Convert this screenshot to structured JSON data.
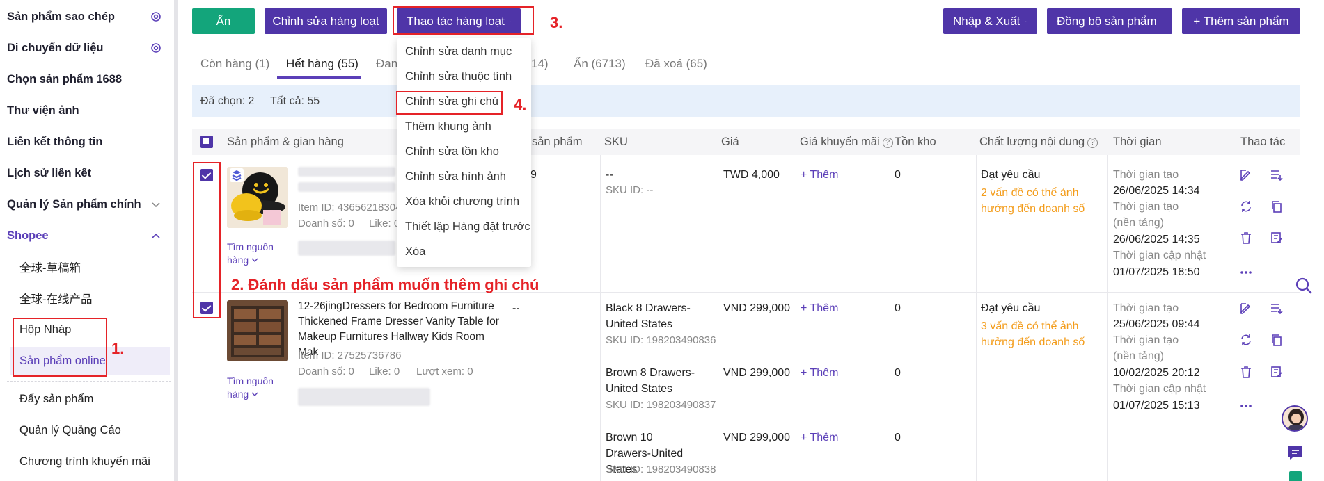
{
  "sidebar": {
    "items": [
      {
        "label": "Sản phẩm sao chép",
        "icon": "gear-icon"
      },
      {
        "label": "Di chuyển dữ liệu",
        "icon": "gear-icon"
      },
      {
        "label": "Chọn sản phẩm 1688"
      },
      {
        "label": "Thư viện ảnh"
      },
      {
        "label": "Liên kết thông tin"
      },
      {
        "label": "Lịch sử liên kết"
      },
      {
        "label": "Quản lý Sản phẩm chính",
        "icon": "chevron-down-icon"
      },
      {
        "label": "Shopee",
        "icon": "chevron-up-icon"
      }
    ],
    "sub_items": [
      "全球-草稿箱",
      "全球-在线产品",
      "Hộp Nháp",
      "Sản phẩm online"
    ],
    "lower_items": [
      "Đẩy sản phẩm",
      "Quản lý Quảng Cáo",
      "Chương trình khuyến mãi"
    ]
  },
  "toolbar": {
    "hide_label": "Ẩn",
    "bulk_edit_label": "Chỉnh sửa hàng loạt",
    "bulk_action_label": "Thao tác hàng loạt",
    "import_export_label": "Nhập & Xuất",
    "sync_label": "Đồng bộ sản phẩm",
    "add_label": "+ Thêm sản phẩm"
  },
  "tabs": [
    {
      "label": "Còn hàng (1)"
    },
    {
      "label": "Hết hàng (55)"
    },
    {
      "label": "Đang"
    },
    {
      "label": "14)"
    },
    {
      "label": "Ẩn (6713)"
    },
    {
      "label": "Đã xoá (65)"
    }
  ],
  "selection": {
    "selected": "Đã chọn: 2",
    "total": "Tất cả: 55"
  },
  "table": {
    "headers": {
      "product": "Sản phẩm & gian hàng",
      "product_partial": "sản phẩm",
      "sku": "SKU",
      "price": "Giá",
      "promo_price": "Giá khuyến mãi",
      "stock": "Tồn kho",
      "quality": "Chất lượng nội dung",
      "time": "Thời gian",
      "actions": "Thao tác"
    },
    "rows": [
      {
        "title_blurred": "1111111111",
        "item_id": "Item ID: 43656218304",
        "sales": "Doanh số: 0",
        "likes": "Like: 0",
        "source_link": "Tìm nguồn hàng",
        "col_partial": "9",
        "skus": [
          {
            "name": "--",
            "sku_id": "SKU ID: --",
            "price": "TWD 4,000",
            "promo": "+ Thêm",
            "stock": "0"
          }
        ],
        "quality": "Đạt yêu cầu",
        "quality_warn": "2 vấn đề có thể ảnh hưởng đến doanh số",
        "time": {
          "created_label": "Thời gian tạo",
          "created": "26/06/2025 14:34",
          "platform_label": "Thời gian tạo (nền tảng)",
          "platform": "26/06/2025 14:35",
          "updated_label": "Thời gian cập nhật",
          "updated": "01/07/2025 18:50"
        }
      },
      {
        "title": "12-26jingDressers for Bedroom Furniture Thickened Frame Dresser Vanity Table for Makeup Furnitures Hallway Kids Room Mak",
        "item_id": "Item ID: 27525736786",
        "sales": "Doanh số: 0",
        "likes": "Like: 0",
        "views": "Lượt xem: 0",
        "source_link": "Tìm nguồn hàng",
        "col_partial": "--",
        "skus": [
          {
            "name": "Black   8 Drawers-United States",
            "sku_id": "SKU ID: 198203490836",
            "price": "VND 299,000",
            "promo": "+ Thêm",
            "stock": "0"
          },
          {
            "name": "Brown   8 Drawers-United States",
            "sku_id": "SKU ID: 198203490837",
            "price": "VND 299,000",
            "promo": "+ Thêm",
            "stock": "0"
          },
          {
            "name": "Brown   10 Drawers-United States",
            "sku_id": "SKU ID: 198203490838",
            "price": "VND 299,000",
            "promo": "+ Thêm",
            "stock": "0"
          }
        ],
        "quality": "Đạt yêu cầu",
        "quality_warn": "3 vấn đề có thể ảnh hưởng đến doanh số",
        "time": {
          "created_label": "Thời gian tạo",
          "created": "25/06/2025 09:44",
          "platform_label": "Thời gian tạo (nền tảng)",
          "platform": "10/02/2025 20:12",
          "updated_label": "Thời gian cập nhật",
          "updated": "01/07/2025 15:13"
        }
      }
    ]
  },
  "dropdown": {
    "items": [
      "Chỉnh sửa danh mục",
      "Chỉnh sửa thuộc tính",
      "Chỉnh sửa ghi chú",
      "Thêm khung ảnh",
      "Chỉnh sửa tồn kho",
      "Chỉnh sửa hình ảnh",
      "Xóa khỏi chương trình",
      "Thiết lập Hàng đặt trước",
      "Xóa"
    ]
  },
  "annotations": {
    "step1": "1.",
    "step2": "2. Đánh dấu sản phẩm muốn thêm ghi chú",
    "step3": "3.",
    "step4": "4."
  },
  "colors": {
    "accent": "#4f35a8",
    "green": "#13a57b",
    "annotation": "#e52328",
    "warning": "#f39c1a"
  }
}
